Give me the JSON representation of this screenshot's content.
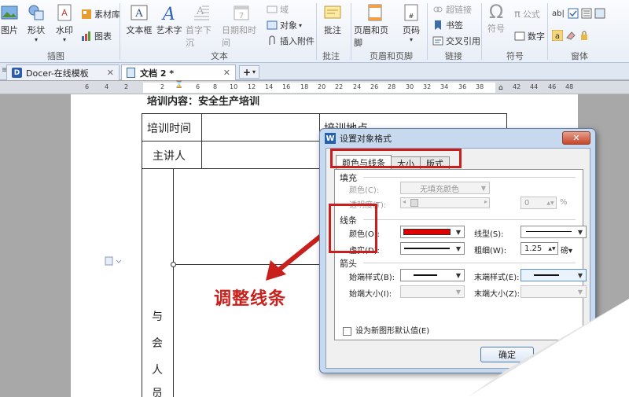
{
  "ribbon": {
    "buttons": {
      "picture": "图片",
      "shape": "形状",
      "watermark": "水印",
      "material": "素材库",
      "chart": "图表",
      "textbox": "文本框",
      "wordart": "艺术字",
      "dropcap": "首字下沉",
      "datetime": "日期和时间",
      "field": "域",
      "object": "对象",
      "attachment": "插入附件",
      "comment": "批注",
      "headerfooter": "页眉和页脚",
      "pagenum": "页码",
      "hyperlink": "超链接",
      "bookmark": "书签",
      "crossref": "交叉引用",
      "symbol": "符号",
      "formula": "公式",
      "number": "数字"
    },
    "groups": {
      "illustration": "插图",
      "text": "文本",
      "comment": "批注",
      "headerfooter": "页眉和页脚",
      "link": "链接",
      "symbol": "符号",
      "form": "窗体"
    }
  },
  "tabs": [
    {
      "label": "Docer-在线模板"
    },
    {
      "label": "文档 2 *"
    }
  ],
  "ruler": {
    "numbers": [
      "6",
      "4",
      "2",
      "2",
      "6",
      "8",
      "10",
      "12",
      "14",
      "16",
      "18",
      "20",
      "22",
      "24",
      "26",
      "28",
      "30",
      "32",
      "34",
      "36",
      "38",
      "42",
      "44",
      "46",
      "48"
    ]
  },
  "document": {
    "title": "培训内容：安全生产培训",
    "cells": {
      "train_time": "培训时间",
      "train_place": "培训地点",
      "speaker": "主讲人",
      "attendees": [
        "与",
        "会",
        "人",
        "员"
      ]
    }
  },
  "dialog": {
    "title": "设置对象格式",
    "close": "✕",
    "tabs": [
      "颜色与线条",
      "大小",
      "版式"
    ],
    "fill": {
      "section": "填充",
      "color_label": "颜色(C):",
      "color_value": "无填充颜色",
      "transparency_label": "透明度(T):",
      "transparency_value": "0",
      "transparency_unit": "%"
    },
    "line": {
      "section": "线条",
      "color_label": "颜色(O):",
      "color_value": "#e00000",
      "style_label": "线型(S):",
      "dash_label": "虚实(D):",
      "weight_label": "粗细(W):",
      "weight_value": "1.25",
      "weight_unit": "磅"
    },
    "arrows": {
      "section": "箭头",
      "begin_style_label": "始端样式(B):",
      "end_style_label": "末端样式(E):",
      "begin_size_label": "始端大小(I):",
      "end_size_label": "末端大小(Z):"
    },
    "default_checkbox": "设为新图形默认值(E)",
    "ok": "确定"
  },
  "annotation": "调整线条",
  "colors": {
    "accent_red": "#c8201c",
    "line_red": "#e00000"
  }
}
